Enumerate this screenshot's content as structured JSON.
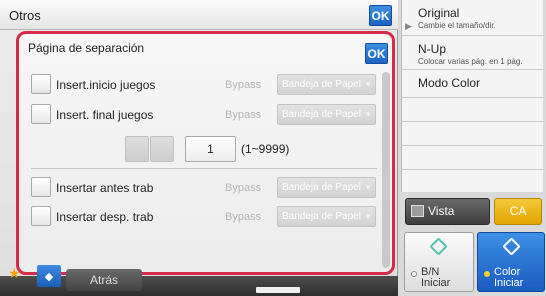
{
  "main": {
    "title": "Otros",
    "ok_label": "OK"
  },
  "dialog": {
    "title": "Página de separación",
    "ok_label": "OK",
    "rows": [
      {
        "label": "Insert.inicio juegos",
        "bypass": "Bypass",
        "tray": "Bandeja de Papel"
      },
      {
        "label": "Insert. final juegos",
        "bypass": "Bypass",
        "tray": "Bandeja de Papel"
      },
      {
        "label": "Insertar antes trab",
        "bypass": "Bypass",
        "tray": "Bandeja de Papel"
      },
      {
        "label": "Insertar desp. trab",
        "bypass": "Bypass",
        "tray": "Bandeja de Papel"
      }
    ],
    "stepper": {
      "value": "1",
      "range": "(1~9999)"
    }
  },
  "bottom_bar": {
    "back_label": "Atrás"
  },
  "right_panel": {
    "items": [
      {
        "title": "Original",
        "subtitle": "Cambie el tamaño/dir."
      },
      {
        "title": "N-Up",
        "subtitle": "Colocar varias pág. en 1 pág."
      },
      {
        "title": "Modo Color",
        "subtitle": ""
      }
    ],
    "preview_label": "Vista previa",
    "ca_label": "CA",
    "bn_start": {
      "line1": "B/N",
      "line2": "Iniciar"
    },
    "color_start": {
      "line1": "Color",
      "line2": "Iniciar"
    }
  },
  "colors": {
    "accent_blue": "#1a63c4",
    "dialog_border": "#d9294b",
    "ca_yellow": "#e3a400"
  }
}
